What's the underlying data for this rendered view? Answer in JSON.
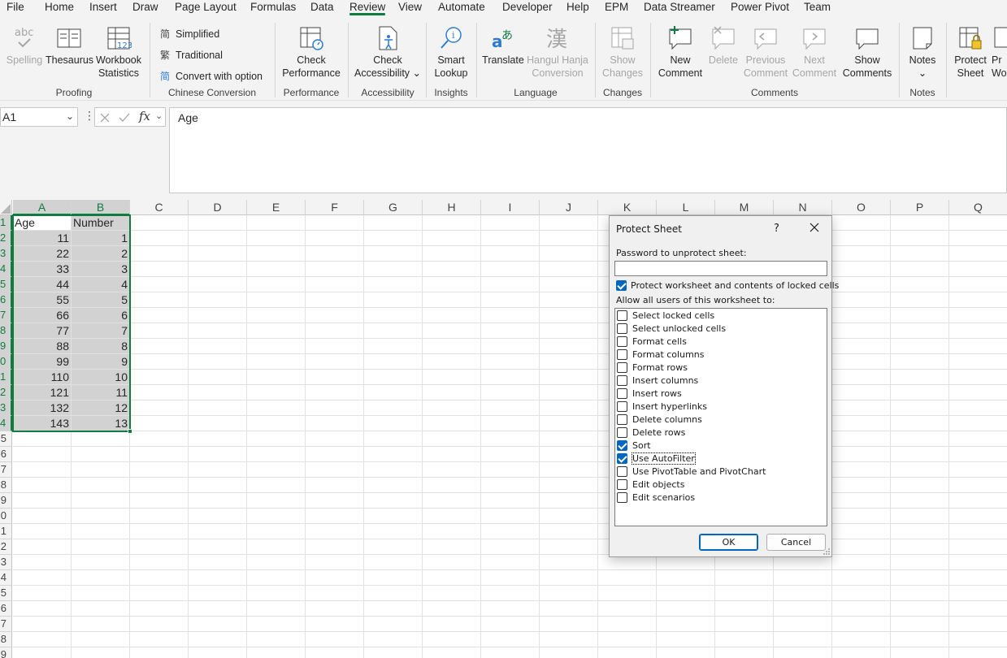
{
  "menu": [
    "File",
    "Home",
    "Insert",
    "Draw",
    "Page Layout",
    "Formulas",
    "Data",
    "Review",
    "View",
    "Automate",
    "Developer",
    "Help",
    "EPM",
    "Data Streamer",
    "Power Pivot",
    "Team"
  ],
  "ribbon": {
    "spelling": "Spelling",
    "thesaurus": "Thesaurus",
    "workbook_stats": [
      "Workbook",
      "Statistics"
    ],
    "proofing": "Proofing",
    "simplified": "Simplified",
    "traditional": "Traditional",
    "convert": "Convert with option",
    "chinese_conversion": "Chinese Conversion",
    "check_performance": [
      "Check",
      "Performance"
    ],
    "performance": "Performance",
    "check_accessibility": [
      "Check",
      "Accessibility ⌄"
    ],
    "accessibility": "Accessibility",
    "smart_lookup": [
      "Smart",
      "Lookup"
    ],
    "insights": "Insights",
    "translate": "Translate",
    "hangul_hanja": [
      "Hangul Hanja",
      "Conversion"
    ],
    "language": "Language",
    "show_changes": [
      "Show",
      "Changes"
    ],
    "changes": "Changes",
    "new_comment": [
      "New",
      "Comment"
    ],
    "delete": "Delete",
    "previous_comment": [
      "Previous",
      "Comment"
    ],
    "next_comment": [
      "Next",
      "Comment"
    ],
    "show_comments": [
      "Show",
      "Comments"
    ],
    "comments": "Comments",
    "notes_btn": [
      "Notes",
      "⌄"
    ],
    "notes": "Notes",
    "protect_sheet": [
      "Protect",
      "Sheet"
    ],
    "protect_workbook": [
      "Pr",
      "Wo"
    ]
  },
  "formula_bar": {
    "name_box": "A1",
    "fx": "fx",
    "content": "Age"
  },
  "grid": {
    "columns": [
      "A",
      "B",
      "C",
      "D",
      "E",
      "F",
      "G",
      "H",
      "I",
      "J",
      "K",
      "L",
      "M",
      "N",
      "O",
      "P",
      "Q"
    ],
    "row_labels": [
      "1",
      "2",
      "3",
      "4",
      "5",
      "6",
      "7",
      "8",
      "9",
      "0",
      "1",
      "2",
      "3",
      "4",
      "5",
      "6",
      "7",
      "8",
      "9",
      "0",
      "1",
      "2",
      "3",
      "4",
      "5",
      "6",
      "7",
      "8",
      "9"
    ],
    "header_row": [
      "Age",
      "Number"
    ],
    "rows": [
      [
        "11",
        "1"
      ],
      [
        "22",
        "2"
      ],
      [
        "33",
        "3"
      ],
      [
        "44",
        "4"
      ],
      [
        "55",
        "5"
      ],
      [
        "66",
        "6"
      ],
      [
        "77",
        "7"
      ],
      [
        "88",
        "8"
      ],
      [
        "99",
        "9"
      ],
      [
        "110",
        "10"
      ],
      [
        "121",
        "11"
      ],
      [
        "132",
        "12"
      ],
      [
        "143",
        "13"
      ]
    ]
  },
  "dialog": {
    "title": "Protect Sheet",
    "help": "?",
    "password_label": "Password to unprotect sheet:",
    "protect_label": "Protect worksheet and contents of locked cells",
    "protect_checked": true,
    "allow_label": "Allow all users of this worksheet to:",
    "options": [
      {
        "label": "Select locked cells",
        "checked": false
      },
      {
        "label": "Select unlocked cells",
        "checked": false
      },
      {
        "label": "Format cells",
        "checked": false
      },
      {
        "label": "Format columns",
        "checked": false
      },
      {
        "label": "Format rows",
        "checked": false
      },
      {
        "label": "Insert columns",
        "checked": false
      },
      {
        "label": "Insert rows",
        "checked": false
      },
      {
        "label": "Insert hyperlinks",
        "checked": false
      },
      {
        "label": "Delete columns",
        "checked": false
      },
      {
        "label": "Delete rows",
        "checked": false
      },
      {
        "label": "Sort",
        "checked": true
      },
      {
        "label": "Use AutoFilter",
        "checked": true
      },
      {
        "label": "Use PivotTable and PivotChart",
        "checked": false
      },
      {
        "label": "Edit objects",
        "checked": false
      },
      {
        "label": "Edit scenarios",
        "checked": false
      }
    ],
    "ok": "OK",
    "cancel": "Cancel"
  },
  "colors": {
    "accent": "#107c41",
    "dialog_blue": "#0067c0",
    "selection": "#d2d2d2"
  }
}
